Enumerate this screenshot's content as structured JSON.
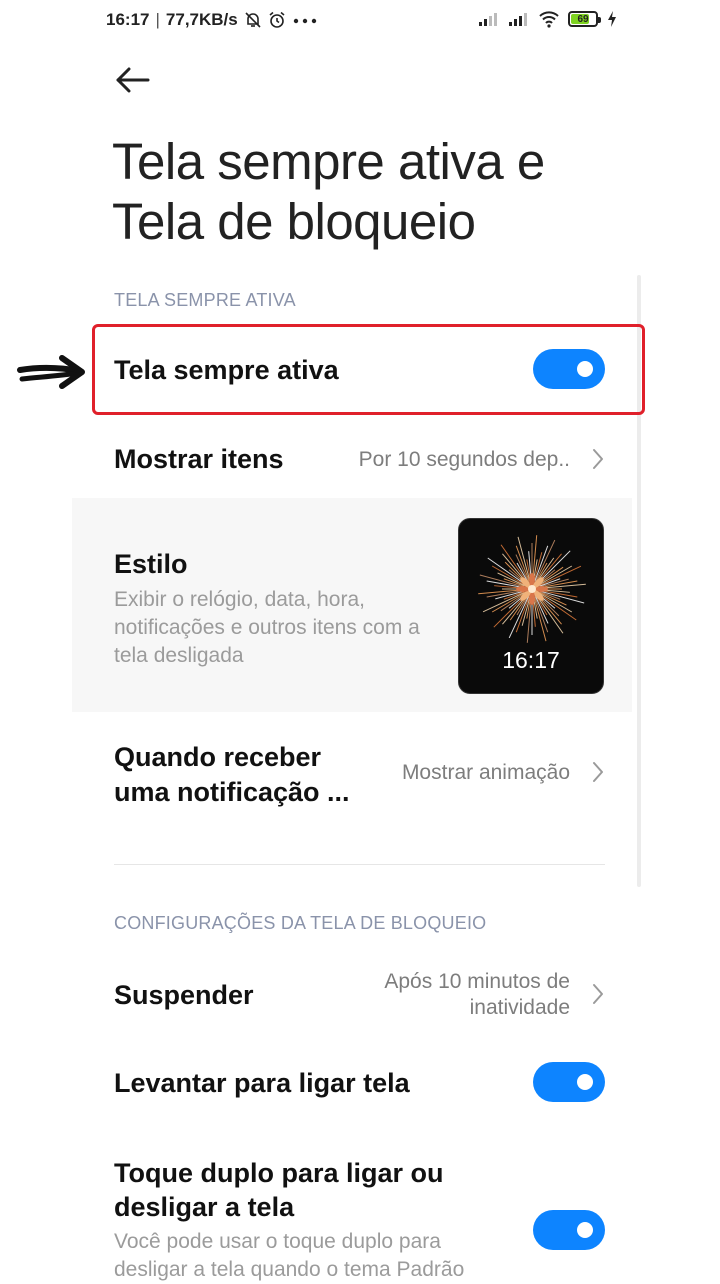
{
  "status_bar": {
    "time": "16:17",
    "network_speed": "77,7KB/s",
    "battery_level": "69",
    "icons": [
      "bell-off-icon",
      "alarm-icon",
      "more-dots-icon",
      "signal-icon",
      "signal-icon",
      "wifi-icon",
      "battery-icon",
      "charging-icon"
    ]
  },
  "header": {
    "back_icon": "arrow-left-icon",
    "title": "Tela sempre ativa e Tela de bloqueio"
  },
  "always_on_section": {
    "header": "TELA SEMPRE ATIVA",
    "always_on": {
      "label": "Tela sempre ativa",
      "enabled": true
    },
    "show_items": {
      "label": "Mostrar itens",
      "value": "Por 10 segundos dep.."
    },
    "style": {
      "label": "Estilo",
      "description": "Exibir o relógio, data, hora, notificações e outros itens com a tela desligada",
      "preview_time": "16:17"
    },
    "notification": {
      "label": "Quando receber uma notificação ...",
      "value": "Mostrar animação"
    }
  },
  "lock_screen_section": {
    "header": "CONFIGURAÇÕES DA TELA DE BLOQUEIO",
    "sleep": {
      "label": "Suspender",
      "value": "Após 10 minutos de inatividade"
    },
    "raise_to_wake": {
      "label": "Levantar para ligar tela",
      "enabled": true
    },
    "double_tap": {
      "label": "Toque duplo para ligar ou desligar a tela",
      "description": "Você pode usar o toque duplo para desligar a tela quando o tema Padrão",
      "enabled": true
    }
  },
  "colors": {
    "accent": "#0d84ff",
    "highlight": "#e0202a",
    "section_header": "#8a93aa"
  }
}
